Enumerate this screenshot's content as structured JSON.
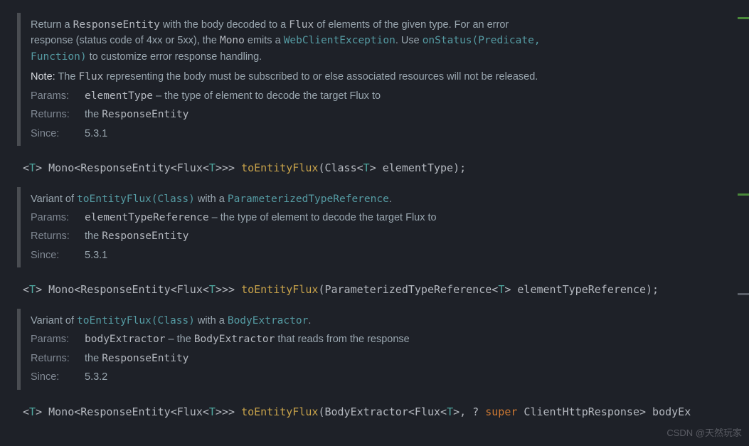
{
  "block1": {
    "desc_pre": "Return a ",
    "desc_code1": "ResponseEntity",
    "desc_mid1": " with the body decoded to a ",
    "desc_code2": "Flux",
    "desc_mid2": " of elements of the given type. For an error response (status code of 4xx or 5xx), the ",
    "desc_code3": "Mono",
    "desc_mid3": " emits a ",
    "desc_link1": "WebClientException",
    "desc_mid4": ". Use ",
    "desc_link2": "onStatus(Predicate, Function)",
    "desc_end": " to customize error response handling.",
    "note_label": "Note:",
    "note_pre": " The ",
    "note_code1": "Flux",
    "note_rest": " representing the body must be subscribed to or else associated resources will not be released.",
    "params_label": "Params:",
    "param_name": "elementType",
    "param_desc": " – the type of element to decode the target Flux to",
    "returns_label": "Returns:",
    "returns_pre": "the ",
    "returns_code": "ResponseEntity",
    "since_label": "Since:",
    "since_val": "5.3.1"
  },
  "sig1": {
    "lt": "<",
    "T": "T",
    "gt": "> Mono<ResponseEntity<Flux<",
    "gt2": ">>> ",
    "method": "toEntityFlux",
    "args_pre": "(Class<",
    "args_post": "> elementType);"
  },
  "block2": {
    "desc_pre": "Variant of ",
    "desc_link1": "toEntityFlux(Class)",
    "desc_mid": " with a ",
    "desc_link2": "ParameterizedTypeReference",
    "desc_end": ".",
    "params_label": "Params:",
    "param_name": "elementTypeReference",
    "param_desc": " – the type of element to decode the target Flux to",
    "returns_label": "Returns:",
    "returns_pre": "the ",
    "returns_code": "ResponseEntity",
    "since_label": "Since:",
    "since_val": "5.3.1"
  },
  "sig2": {
    "lt": "<",
    "T": "T",
    "gt": "> Mono<ResponseEntity<Flux<",
    "gt2": ">>> ",
    "method": "toEntityFlux",
    "args_pre": "(ParameterizedTypeReference<",
    "args_post": "> elementTypeReference);"
  },
  "block3": {
    "desc_pre": "Variant of ",
    "desc_link1": "toEntityFlux(Class)",
    "desc_mid": " with a ",
    "desc_link2": "BodyExtractor",
    "desc_end": ".",
    "params_label": "Params:",
    "param_name": "bodyExtractor",
    "param_desc_pre": " – the ",
    "param_desc_code": "BodyExtractor",
    "param_desc_post": " that reads from the response",
    "returns_label": "Returns:",
    "returns_pre": "the ",
    "returns_code": "ResponseEntity",
    "since_label": "Since:",
    "since_val": "5.3.2"
  },
  "sig3": {
    "lt": "<",
    "T": "T",
    "gt": "> Mono<ResponseEntity<Flux<",
    "gt2": ">>> ",
    "method": "toEntityFlux",
    "args_pre": "(BodyExtractor<Flux<",
    "args_mid": ">, ? ",
    "kw": "super",
    "args_post": " ClientHttpResponse> bodyEx"
  },
  "watermark": "CSDN @天然玩家"
}
